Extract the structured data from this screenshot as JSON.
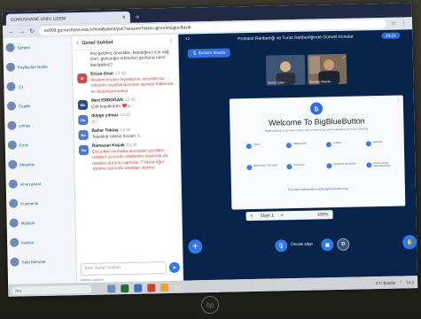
{
  "browser": {
    "tab_title": "GUMUSHANE UNIV. UZEM",
    "url": "ss909.gumushane.edu.tr/html5client/join?sessionToken=ghzmmcqjucfbtzlb"
  },
  "userlist": {
    "items": [
      {
        "initials": "",
        "label": "Sohbet"
      },
      {
        "initials": "",
        "label": "Paylaşılan Notlar"
      },
      {
        "initials": "",
        "label": "(2)"
      },
      {
        "initials": "",
        "label": "Özellik"
      },
      {
        "initials": "",
        "label": "yılmaz"
      },
      {
        "initials": "",
        "label": "Emni"
      },
      {
        "initials": "",
        "label": "Meşelek"
      },
      {
        "initials": "",
        "label": "nihan gazar"
      },
      {
        "initials": "",
        "label": "Kuymenik"
      },
      {
        "initials": "",
        "label": "Müslüm"
      },
      {
        "initials": "",
        "label": "Kanbur"
      },
      {
        "initials": "",
        "label": "Safa Mehmet"
      }
    ]
  },
  "chat": {
    "title": "Genel Sohbet",
    "messages": [
      {
        "initials": "",
        "color": "#ffffff",
        "name": "",
        "time": "",
        "text": "hoş geldiniz öncelikle. katıldığınız için sağ olun. geleceğin rehberleri grubuna nasıl katılabiliriz?",
        "red": false
      },
      {
        "initials": "Er",
        "color": "#d24a4a",
        "name": "Ercan Onat",
        "time": "13:40",
        "text": "İbrahim hocam feyekkürler öncelikle bir rehberin seyahat acentası açması hakkında ne düşünüyorsunuz",
        "red": true
      },
      {
        "initials": "Me",
        "color": "#2f4a86",
        "name": "Mert ERDOĞAN",
        "time": "13:40",
        "text": "Çok teşekkürler ❤️⚠",
        "red": false
      },
      {
        "initials": "Du",
        "color": "#4a7ad0",
        "name": "duygu yılmaz",
        "time": "13:40",
        "text": "⚠♡",
        "red": false
      },
      {
        "initials": "Ba",
        "color": "#4a7ad0",
        "name": "Bahar Toktaş",
        "time": "13:40",
        "text": "Teşekkür ederiz hocam ⚠",
        "red": false
      },
      {
        "initials": "Ra",
        "color": "#4a7ad0",
        "name": "Ramazan Koçak",
        "time": "13:40",
        "text": "Öncelikle merhaba acentalar işsizlikler rekabet üzerinde rekabetler arasında da rekabet durumu varmıdır ? Varsa eğer işletme üzerinde zararları olurmu",
        "red": true
      }
    ],
    "input_placeholder": "Bahi Genel Sohbet",
    "typing": "Katılımcı yazıyor"
  },
  "main": {
    "meeting_title": "Protokol Rehberliği ve Turist Rehberliğinde Güncel Konular",
    "record_label": "49:24",
    "presenter_name": "İbrahim Mayda",
    "cams": [
      {
        "label": "İsmail Çakır"
      },
      {
        "label": "İbrahim Mayda"
      }
    ],
    "slide": {
      "logo_letter": "b",
      "title": "Welcome To BigBlueButton",
      "subtitle": "BigBlueButton is an open source web conferencing system designed for online learning.",
      "features": [
        "CHAT",
        "WEBCAMS",
        "AUDIO",
        "EMOJIS",
        "BREAKOUT ROOMS",
        "POLLING",
        "SCREEN SHARING",
        "MULTI-USER WHITEBOARD"
      ],
      "link_prefix": "For more information visit",
      "link": "bigbluebutton.org"
    },
    "pager": {
      "prev": "<",
      "page": "Slayt 1",
      "next": ">",
      "zoom": "100%"
    },
    "audio_label": "Önceki slayt"
  },
  "taskbar": {
    "search": "Ara",
    "weather": "2°C Bulutlu",
    "time": "14:1"
  },
  "brand": {
    "logo": "hp"
  }
}
